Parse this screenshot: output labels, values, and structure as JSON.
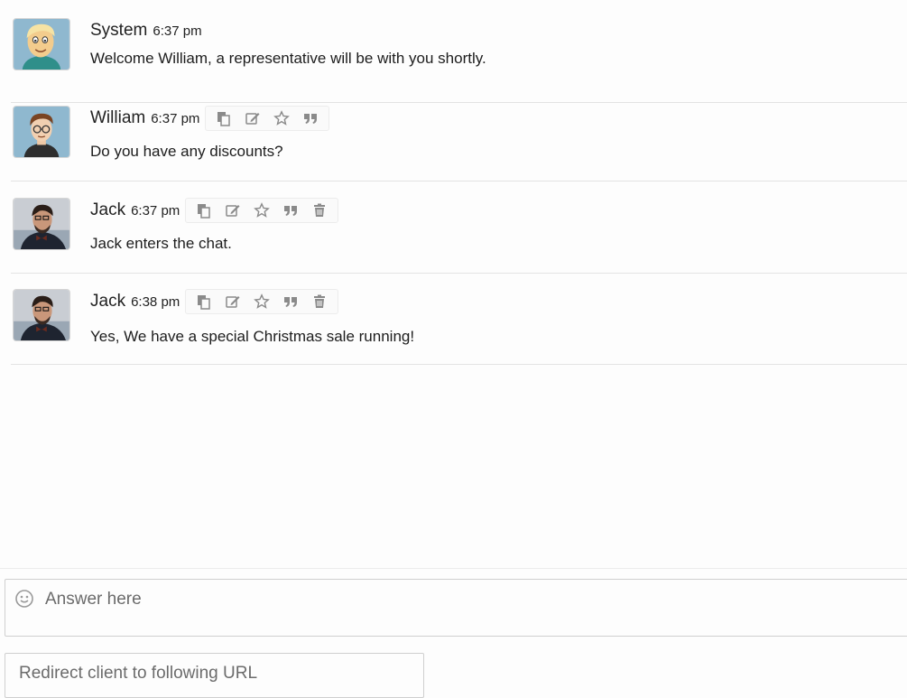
{
  "colors": {
    "icon_gray": "#8a8a8a",
    "border": "#e3e3e3",
    "text": "#1d1d1d"
  },
  "messages": [
    {
      "author": "System",
      "time": "6:37 pm",
      "text": "Welcome William, a representative will be with you shortly.",
      "avatar": "cartoon-blonde-man-avatar",
      "tools": []
    },
    {
      "author": "William",
      "time": "6:37 pm",
      "text": "Do you have any discounts?",
      "avatar": "cartoon-man-with-glasses-avatar",
      "tools": [
        "copy-icon",
        "edit-icon",
        "star-icon",
        "quote-icon"
      ]
    },
    {
      "author": "Jack",
      "time": "6:37 pm",
      "text": "Jack enters the chat.",
      "avatar": "photo-man-bowtie-avatar",
      "tools": [
        "copy-icon",
        "edit-icon",
        "star-icon",
        "quote-icon",
        "trash-icon"
      ]
    },
    {
      "author": "Jack",
      "time": "6:38 pm",
      "text": "Yes, We have a special Christmas sale running!",
      "avatar": "photo-man-bowtie-avatar",
      "tools": [
        "copy-icon",
        "edit-icon",
        "star-icon",
        "quote-icon",
        "trash-icon"
      ]
    }
  ],
  "composer": {
    "placeholder": "Answer here",
    "value": "",
    "emoji_icon": "smile-icon"
  },
  "redirect": {
    "placeholder": "Redirect client to following URL",
    "value": ""
  }
}
